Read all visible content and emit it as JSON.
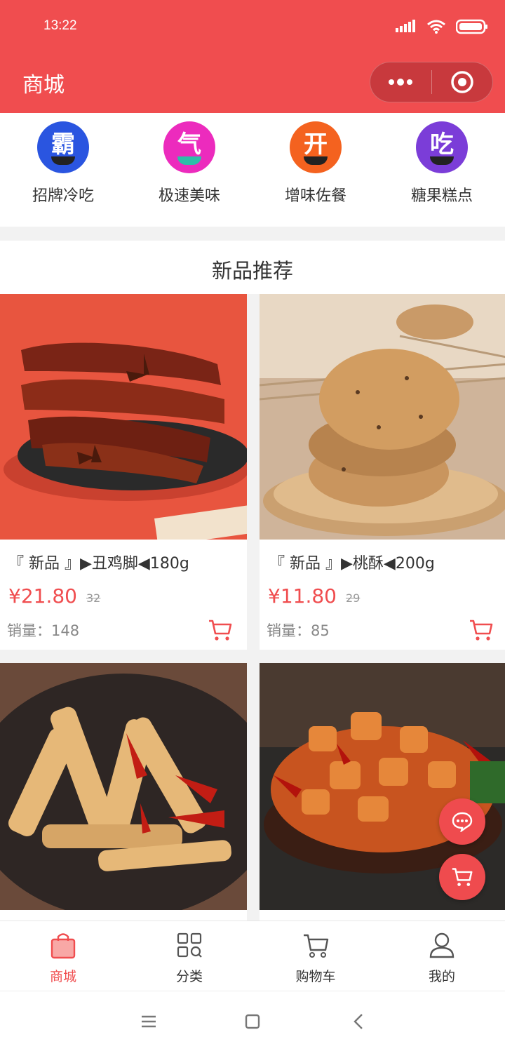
{
  "status_bar": {
    "time": "13:22"
  },
  "nav": {
    "title": "商城"
  },
  "categories": [
    {
      "label": "招牌冷吃",
      "glyph": "霸",
      "color": "#2a55e0"
    },
    {
      "label": "极速美味",
      "glyph": "气",
      "color": "#ec2bbd"
    },
    {
      "label": "增味佐餐",
      "glyph": "开",
      "color": "#f4621f"
    },
    {
      "label": "糖果糕点",
      "glyph": "吃",
      "color": "#7b3dd8"
    }
  ],
  "section": {
    "title": "新品推荐"
  },
  "products": [
    {
      "name": "『 新品 』▶丑鸡脚◀180g",
      "price": "¥21.80",
      "old_price": "32",
      "sales": "销量：148"
    },
    {
      "name": "『 新品 』▶桃酥◀200g",
      "price": "¥11.80",
      "old_price": "29",
      "sales": "销量：85"
    },
    {
      "name": "",
      "price": "",
      "old_price": "",
      "sales": ""
    },
    {
      "name": "",
      "price": "",
      "old_price": "",
      "sales": ""
    }
  ],
  "tabbar": [
    {
      "label": "商城",
      "icon": "bag-icon",
      "active": true
    },
    {
      "label": "分类",
      "icon": "grid-icon",
      "active": false
    },
    {
      "label": "购物车",
      "icon": "cart-icon",
      "active": false
    },
    {
      "label": "我的",
      "icon": "user-icon",
      "active": false
    }
  ],
  "colors": {
    "brand": "#f04d4f",
    "text": "#333333",
    "muted": "#888888"
  }
}
